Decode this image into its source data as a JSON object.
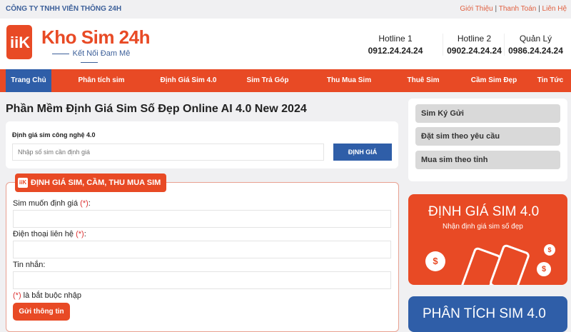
{
  "topbar": {
    "company": "CÔNG TY TNHH VIỄN THÔNG 24H",
    "links": [
      "Giới Thiệu",
      "Thanh Toán",
      "Liên Hệ"
    ],
    "separator": "|"
  },
  "header": {
    "logo_text": "Kho Sim 24h",
    "logo_tagline": "Kết Nối Đam Mê",
    "logo_mark": "iiK",
    "hotlines": [
      {
        "label": "Hotline 1",
        "number": "0912.24.24.24"
      },
      {
        "label": "Hotline 2",
        "number": "0902.24.24.24"
      },
      {
        "label": "Quản Lý",
        "number": "0986.24.24.24"
      }
    ]
  },
  "nav": [
    "Trang Chủ",
    "Phân tích sim",
    "Định Giá Sim 4.0",
    "Sim Trả Góp",
    "Thu Mua Sim",
    "Thuê Sim",
    "Cầm Sim Đẹp",
    "Tin Tức"
  ],
  "main": {
    "title": "Phần Mềm Định Giá Sim Số Đẹp Online AI 4.0 New 2024",
    "search": {
      "label": "Định giá sim công nghệ 4.0",
      "placeholder": "Nhập số sim cần định giá",
      "button": "ĐỊNH GIÁ"
    },
    "form": {
      "badge": "ĐỊNH GIÁ SIM, CẦM, THU MUA SIM",
      "fields": [
        "Sim muốn định giá",
        "Điện thoại liên hệ"
      ],
      "req_mark": "(*)",
      "colon": ":",
      "message_label": "Tin nhắn:",
      "required_note": "là bắt buộc nhập",
      "submit": "Gửi thông tin"
    }
  },
  "sidebar": {
    "buttons": [
      "Sim Ký Gửi",
      "Đặt sim theo yêu cầu",
      "Mua sim theo tỉnh"
    ],
    "banner1": {
      "title": "ĐỊNH GIÁ SIM 4.0",
      "subtitle": "Nhận định giá sim số đẹp"
    },
    "banner2": {
      "title": "PHÂN TÍCH SIM 4.0"
    }
  },
  "colors": {
    "brand": "#e84a25",
    "blue": "#2f5ea8"
  }
}
